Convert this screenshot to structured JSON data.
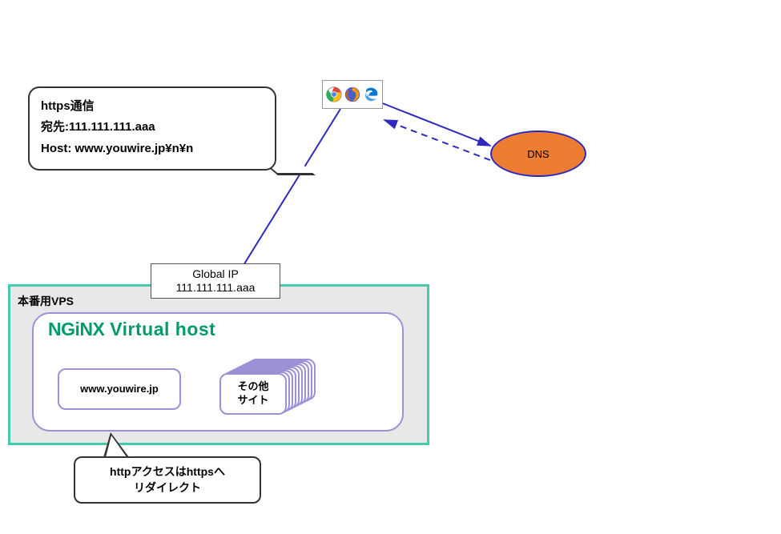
{
  "callout_top": {
    "line1": "https通信",
    "line2": "宛先:111.111.111.aaa",
    "line3": "Host: www.youwire.jp¥n¥n"
  },
  "dns": {
    "label": "DNS"
  },
  "global_ip": {
    "line1": "Global IP",
    "line2": "111.111.111.aaa"
  },
  "vps": {
    "label": "本番用VPS"
  },
  "nginx": {
    "logo_text": "NGiNX",
    "vhost_text": "Virtual host",
    "site1": "www.youwire.jp",
    "site2_line1": "その他",
    "site2_line2": "サイト"
  },
  "callout_bottom": {
    "line1": "httpアクセスはhttpsへ",
    "line2": "リダイレクト"
  },
  "browsers": {
    "chrome": "chrome-icon",
    "firefox": "firefox-icon",
    "edge": "edge-icon"
  },
  "colors": {
    "accent_green": "#48C9A9",
    "nginx_green": "#009B6B",
    "orange": "#ED7D31",
    "purple_border": "#9B92D6",
    "arrow_blue": "#2E2ABF"
  }
}
